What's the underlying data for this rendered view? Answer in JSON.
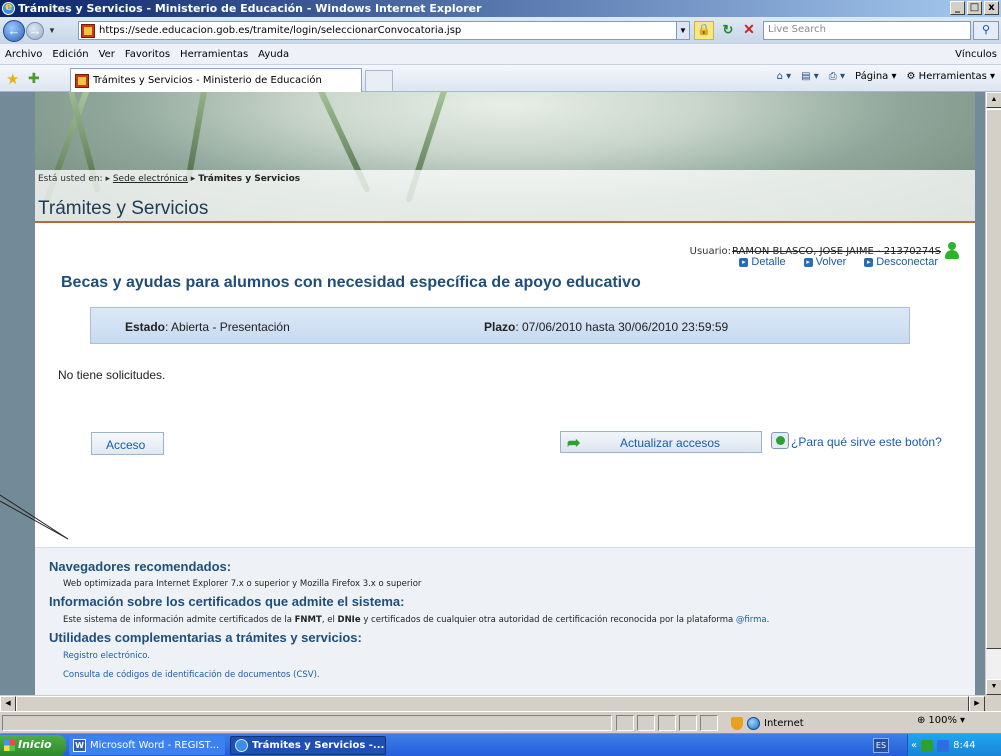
{
  "window": {
    "title": "Trámites y Servicios - Ministerio de Educación - Windows Internet Explorer",
    "minimize": "_",
    "maximize": "□",
    "close": "x"
  },
  "address": {
    "url": "https://sede.educacion.gob.es/tramite/login/seleccionarConvocatoria.jsp",
    "search_placeholder": "Live Search"
  },
  "menu": {
    "items": [
      "Archivo",
      "Edición",
      "Ver",
      "Favoritos",
      "Herramientas",
      "Ayuda"
    ],
    "vinculos": "Vínculos"
  },
  "tab": {
    "label": "Trámites y Servicios - Ministerio de Educación"
  },
  "commandbar": {
    "pagina": "Página",
    "herramientas": "Herramientas"
  },
  "page": {
    "breadcrumb_prefix": "Está usted en:",
    "breadcrumb_link": "Sede electrónica",
    "breadcrumb_current": "Trámites y Servicios",
    "title": "Trámites y Servicios",
    "usuario_label": "Usuario:",
    "usuario_name": "RAMON BLASCO, JOSE JAIME - 21370274S",
    "actions": {
      "detalle": "Detalle",
      "volver": "Volver",
      "desconectar": "Desconectar"
    },
    "heading": "Becas y ayudas para alumnos con necesidad específica de apoyo educativo",
    "estado_label": "Estado",
    "estado_value": ": Abierta - Presentación",
    "plazo_label": "Plazo",
    "plazo_value": ": 07/06/2010 hasta 30/06/2010 23:59:59",
    "no_solicitudes": "No tiene solicitudes.",
    "acceso_button": "Acceso",
    "actualizar_button": "Actualizar accesos",
    "help_link": "¿Para qué sirve este botón?"
  },
  "footer": {
    "navegadores_heading": "Navegadores recomendados:",
    "navegadores_text": "Web optimizada para Internet Explorer 7.x o superior y Mozilla Firefox 3.x o superior",
    "certificados_heading": "Información sobre los certificados que admite el sistema:",
    "certificados_text_1": "Este sistema de información admite certificados de la ",
    "fnmt": "FNMT",
    "certificados_text_2": ", el ",
    "dnie": "DNIe",
    "certificados_text_3": " y certificados de cualquier otra autoridad de certificación reconocida por la plataforma ",
    "firma": "@firma",
    "certificados_text_4": ".",
    "utilidades_heading": "Utilidades complementarias a trámites y servicios:",
    "registro_link": "Registro electrónico.",
    "csv_link": "Consulta de códigos de identificación de documentos (CSV)."
  },
  "statusbar": {
    "zone": "Internet",
    "zoom": "100%"
  },
  "taskbar": {
    "start": "Inicio",
    "word_task": "Microsoft Word - REGIST...",
    "ie_task": "Trámites y Servicios -...",
    "lang": "ES",
    "time": "8:44"
  }
}
